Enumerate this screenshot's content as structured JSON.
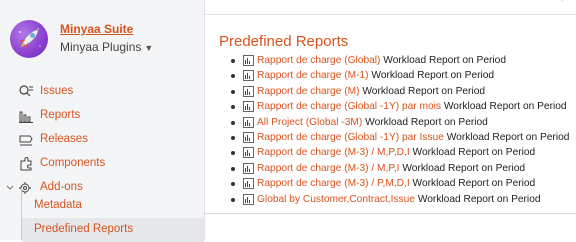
{
  "project": {
    "name": "Minyaa Suite",
    "subtitle": "Minyaa Plugins",
    "avatar_icon": "rocket-icon"
  },
  "nav": [
    {
      "label": "Issues",
      "icon": "issues-icon"
    },
    {
      "label": "Reports",
      "icon": "reports-icon"
    },
    {
      "label": "Releases",
      "icon": "releases-icon"
    },
    {
      "label": "Components",
      "icon": "components-icon"
    },
    {
      "label": "Add-ons",
      "icon": "addons-icon"
    }
  ],
  "subnav": [
    {
      "label": "Metadata",
      "active": false
    },
    {
      "label": "Predefined Reports",
      "active": true
    }
  ],
  "main": {
    "title": "Predefined Reports",
    "reports": [
      {
        "link": "Rapport de charge (Global)",
        "desc": "Workload Report on Period"
      },
      {
        "link": "Rapport de charge (M-1)",
        "desc": "Workload Report on Period"
      },
      {
        "link": "Rapport de charge (M)",
        "desc": "Workload Report on Period"
      },
      {
        "link": "Rapport de charge (Global -1Y) par mois",
        "desc": "Workload Report on Period"
      },
      {
        "link": "All Project (Global -3M)",
        "desc": "Workload Report on Period"
      },
      {
        "link": "Rapport de charge (Global -1Y) par Issue",
        "desc": "Workload Report on Period"
      },
      {
        "link": "Rapport de charge (M-3) / M,P,D,I",
        "desc": "Workload Report on Period"
      },
      {
        "link": "Rapport de charge (M-3) / M,P,I",
        "desc": "Workload Report on Period"
      },
      {
        "link": "Rapport de charge (M-3) / P,M,D,I",
        "desc": "Workload Report on Period"
      },
      {
        "link": "Global by Customer,Contract,Issue",
        "desc": "Workload Report on Period"
      }
    ]
  },
  "colors": {
    "accent": "#d9531e",
    "sidebar_bg": "#f4f5f7",
    "active_bg": "#e6e7ea"
  }
}
